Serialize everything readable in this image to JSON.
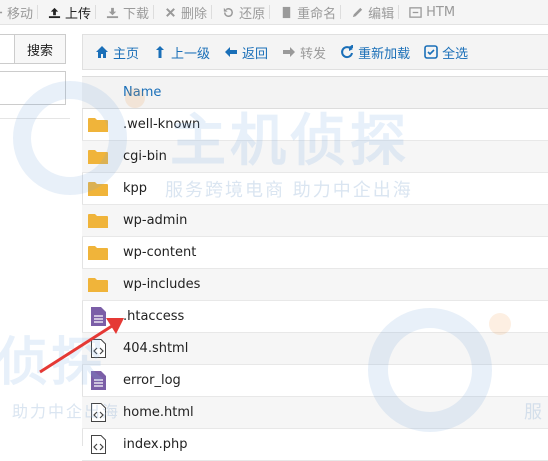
{
  "toolbar": {
    "items": [
      {
        "label": "移动",
        "icon": "move-icon",
        "enabled": false
      },
      {
        "label": "上传",
        "icon": "upload-icon",
        "enabled": true
      },
      {
        "label": "下载",
        "icon": "download-icon",
        "enabled": false
      },
      {
        "label": "删除",
        "icon": "delete-icon",
        "enabled": false
      },
      {
        "label": "还原",
        "icon": "restore-icon",
        "enabled": false
      },
      {
        "label": "重命名",
        "icon": "rename-icon",
        "enabled": false
      },
      {
        "label": "编辑",
        "icon": "edit-icon",
        "enabled": false
      },
      {
        "label": "HTM",
        "icon": "html-editor-icon",
        "enabled": false
      }
    ]
  },
  "search": {
    "button_label": "搜索",
    "input_value": "",
    "path_value": ""
  },
  "navbar": {
    "items": [
      {
        "label": "主页",
        "icon": "home-icon",
        "enabled": true
      },
      {
        "label": "上一级",
        "icon": "level-up-icon",
        "enabled": true
      },
      {
        "label": "返回",
        "icon": "back-arrow-icon",
        "enabled": true
      },
      {
        "label": "转发",
        "icon": "forward-arrow-icon",
        "enabled": false
      },
      {
        "label": "重新加载",
        "icon": "reload-icon",
        "enabled": true
      },
      {
        "label": "全选",
        "icon": "checkbox-icon",
        "enabled": true
      }
    ]
  },
  "table": {
    "name_header": "Name",
    "rows": [
      {
        "name": ".well-known",
        "type": "folder"
      },
      {
        "name": "cgi-bin",
        "type": "folder"
      },
      {
        "name": "kpp",
        "type": "folder"
      },
      {
        "name": "wp-admin",
        "type": "folder"
      },
      {
        "name": "wp-content",
        "type": "folder"
      },
      {
        "name": "wp-includes",
        "type": "folder"
      },
      {
        "name": ".htaccess",
        "type": "text-file"
      },
      {
        "name": "404.shtml",
        "type": "code-file"
      },
      {
        "name": "error_log",
        "type": "text-file"
      },
      {
        "name": "home.html",
        "type": "code-file"
      },
      {
        "name": "index.php",
        "type": "code-file"
      }
    ]
  },
  "watermark": {
    "big": "主机侦探",
    "slogan": "服务跨境电商 助力中企出海",
    "slogan_fragment": "助力中企出海",
    "big_fragment": "侦探",
    "right_fragment": "服"
  },
  "colors": {
    "link": "#1a6fb8",
    "folder": "#f0b43a",
    "text_file": "#7b5ea7",
    "arrow": "#e53935"
  }
}
